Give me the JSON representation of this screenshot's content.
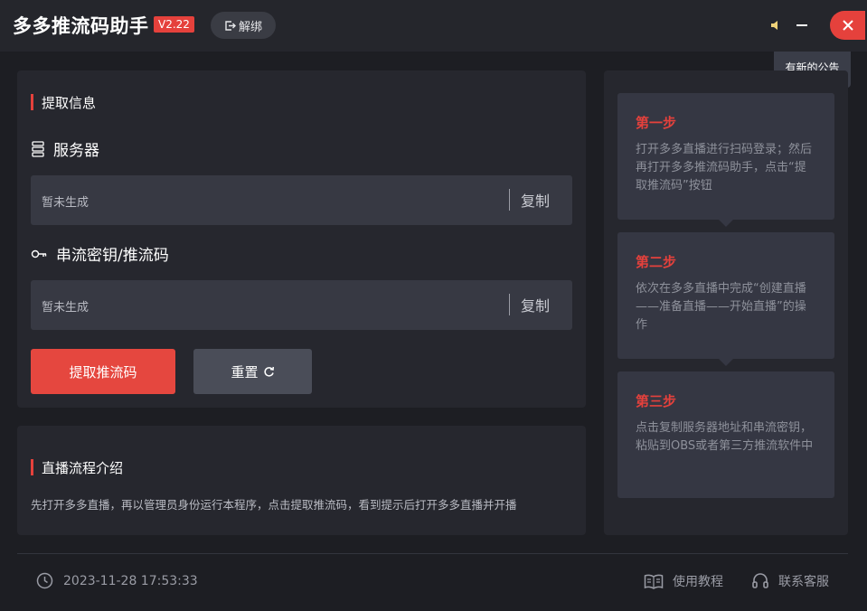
{
  "titlebar": {
    "title": "多多推流码助手",
    "version": "V2.22",
    "unbind_label": "解绑",
    "notice_label": "有新的公告"
  },
  "extract": {
    "section_title": "提取信息",
    "server_label": "服务器",
    "server_value": "暂未生成",
    "key_label": "串流密钥/推流码",
    "key_value": "暂未生成",
    "copy_label": "复制",
    "extract_button": "提取推流码",
    "reset_button": "重置"
  },
  "intro": {
    "section_title": "直播流程介绍",
    "text": "先打开多多直播，再以管理员身份运行本程序，点击提取推流码，看到提示后打开多多直播并开播"
  },
  "steps": [
    {
      "title": "第一步",
      "desc": "打开多多直播进行扫码登录；然后再打开多多推流码助手，点击“提取推流码”按钮"
    },
    {
      "title": "第二步",
      "desc": "依次在多多直播中完成“创建直播——准备直播——开始直播”的操作"
    },
    {
      "title": "第三步",
      "desc": "点击复制服务器地址和串流密钥，粘贴到OBS或者第三方推流软件中"
    }
  ],
  "footer": {
    "datetime": "2023-11-28 17:53:33",
    "tutorial_label": "使用教程",
    "support_label": "联系客服"
  },
  "colors": {
    "accent": "#e5413c",
    "background": "#1d1e23",
    "panel": "#26272e"
  }
}
